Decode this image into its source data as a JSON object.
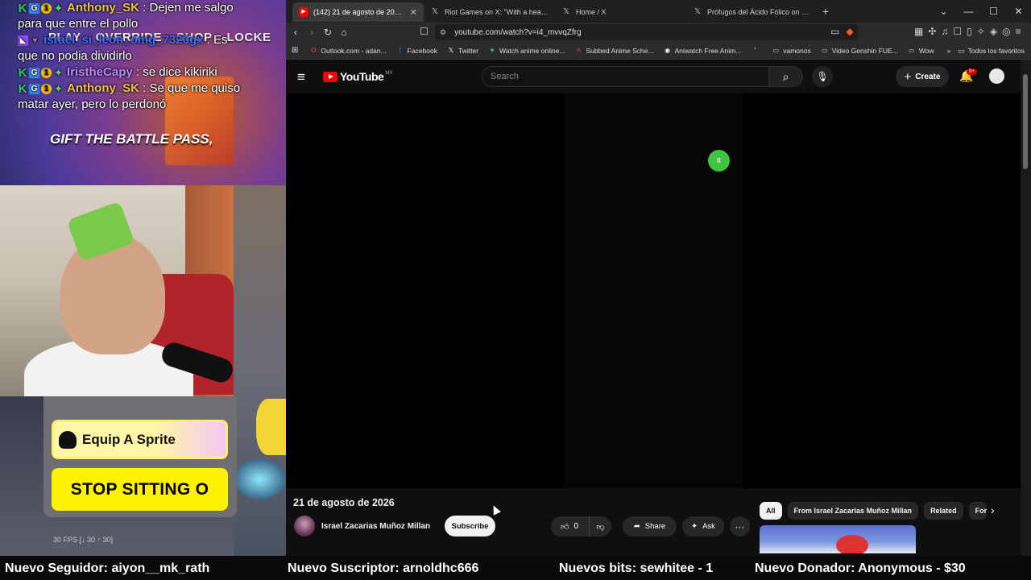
{
  "stream": {
    "game_menu": [
      "PLAY",
      "OVERRIDE",
      "SHOP",
      "LOCKE"
    ],
    "battle_pass_text": "GIFT THE BATTLE PASS,",
    "chat": [
      {
        "user": "Anthony_SK",
        "user_color": "#f0c24a",
        "text": " : Dejen me salgo para que entre el pollo",
        "badges": [
          "k",
          "g",
          "1",
          "s"
        ]
      },
      {
        "user": "israel_si_leon_omg_7320gx",
        "user_color": "#3b6cff",
        "text": " : Es que no podia dividirlo",
        "badges": [
          "tw",
          "heart"
        ]
      },
      {
        "user": "IristheCapy",
        "user_color": "#b98bff",
        "text": " : se dice kikiriki",
        "badges": [
          "k",
          "g",
          "1",
          "s"
        ]
      },
      {
        "user": "Anthony_SK",
        "user_color": "#f0c24a",
        "text": " : Se que me quiso matar ayer, pero lo perdonó",
        "badges": [
          "k",
          "g",
          "1",
          "s"
        ]
      }
    ],
    "sprite_button": "Equip A Sprite",
    "stop_button": "STOP SITTING O",
    "fps": "30 FPS [↓ 30 ↑ 30]"
  },
  "browser": {
    "tabs": [
      {
        "title": "(142) 21 de agosto de 2026 - Yo",
        "icon": "youtube-icon",
        "active": true
      },
      {
        "title": "Riot Games on X: \"With a heavy hear",
        "icon": "x-icon",
        "active": false
      },
      {
        "title": "Home / X",
        "icon": "x-icon",
        "active": false
      },
      {
        "title": "Prófugos del Ácido Fólico on X: \"De",
        "icon": "x-icon",
        "active": false
      }
    ],
    "url": "youtube.com/watch?v=i4_mvvqZfrg",
    "bookmarks": [
      {
        "label": "Outlook.com - adan...",
        "icon": "outlook-icon",
        "color": "#f25022"
      },
      {
        "label": "Facebook",
        "icon": "facebook-icon",
        "color": "#1877f2"
      },
      {
        "label": "Twitter",
        "icon": "x-icon",
        "color": "#ffffff"
      },
      {
        "label": "Watch anime online...",
        "icon": "anime-icon",
        "color": "#2ecc71"
      },
      {
        "label": "Subbed Anime Sche...",
        "icon": "anime-schedule-icon",
        "color": "#e0303a"
      },
      {
        "label": "Aniwatch Free Anim...",
        "icon": "aniwatch-icon",
        "color": "#ffffff"
      },
      {
        "label": "",
        "icon": "misc-icon",
        "color": "#cccccc"
      },
      {
        "label": "vamonos",
        "icon": "folder-icon",
        "color": "#cccccc"
      },
      {
        "label": "Video Genshin FUE...",
        "icon": "folder-icon",
        "color": "#cccccc"
      },
      {
        "label": "Wow",
        "icon": "folder-icon",
        "color": "#cccccc"
      }
    ],
    "bookmarks_right": "Todos los favoritos"
  },
  "youtube": {
    "logo_text": "YouTube",
    "country": "MX",
    "search_placeholder": "Search",
    "create_label": "Create",
    "notif_badge": "9+",
    "pause_badge": "II",
    "video_title": "21 de agosto de 2026",
    "channel_name": "Israel Zacarias Muñoz Millan",
    "subscribe_label": "Subscribe",
    "like_count": "0",
    "share_label": "Share",
    "ask_label": "Ask",
    "chips": [
      "All",
      "From Israel Zacarias Muñoz Millan",
      "Related",
      "For"
    ]
  },
  "ticker": [
    "Nuevo Seguidor: aiyon__mk_rath",
    "Nuevo Suscriptor: arnoldhc666",
    "Nuevos bits: sewhitee - 1",
    "Nuevo Donador: Anonymous - $30"
  ]
}
